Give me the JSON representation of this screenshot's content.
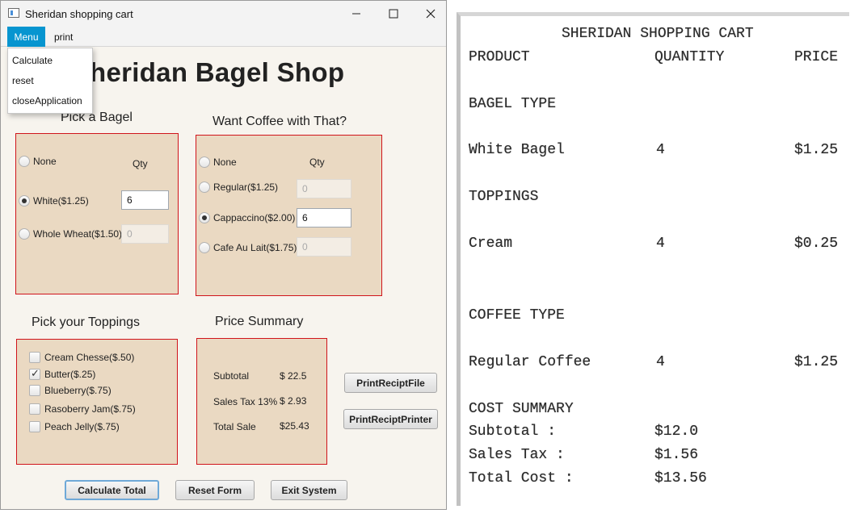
{
  "window": {
    "title": "Sheridan shopping cart",
    "controls": {
      "minimize": "—",
      "maximize": "☐",
      "close": "✕"
    }
  },
  "menubar": {
    "menu_label": "Menu",
    "print_label": "print",
    "dropdown_items": [
      "Calculate",
      "reset",
      "closeApplication"
    ]
  },
  "shop_title": "heridan Bagel Shop",
  "bagel_section": {
    "title": "Pick a Bagel",
    "qty_header": "Qty",
    "options": [
      {
        "label": "None",
        "selected": false,
        "qty": null
      },
      {
        "label": "White($1.25)",
        "selected": true,
        "qty": "6"
      },
      {
        "label": "Whole Wheat($1.50)",
        "selected": false,
        "qty": "0"
      }
    ]
  },
  "coffee_section": {
    "title": "Want Coffee with That?",
    "qty_header": "Qty",
    "options": [
      {
        "label": "None",
        "selected": false,
        "qty": null
      },
      {
        "label": "Regular($1.25)",
        "selected": false,
        "qty": "0"
      },
      {
        "label": "Cappaccino($2.00)",
        "selected": true,
        "qty": "6"
      },
      {
        "label": "Cafe Au Lait($1.75)",
        "selected": false,
        "qty": "0"
      }
    ]
  },
  "toppings_section": {
    "title": "Pick your Toppings",
    "items": [
      {
        "label": "Cream Chesse($.50)",
        "checked": false
      },
      {
        "label": "Butter($.25)",
        "checked": true
      },
      {
        "label": "Blueberry($.75)",
        "checked": false
      },
      {
        "label": "Rasoberry Jam($.75)",
        "checked": false
      },
      {
        "label": "Peach Jelly($.75)",
        "checked": false
      }
    ]
  },
  "price_summary": {
    "title": "Price Summary",
    "rows": [
      {
        "label": "Subtotal",
        "value": "$ 22.5"
      },
      {
        "label": "Sales Tax 13%",
        "value": "$ 2.93"
      },
      {
        "label": "Total Sale",
        "value": "$25.43"
      }
    ]
  },
  "print_buttons": {
    "file": "PrintReciptFile",
    "printer": "PrintReciptPrinter"
  },
  "bottom_buttons": {
    "calculate": "Calculate Total",
    "reset": "Reset Form",
    "exit": "Exit System"
  },
  "receipt": {
    "heading": "SHERIDAN SHOPPING CART",
    "col_product": "PRODUCT",
    "col_quantity": "QUANTITY",
    "col_price": "PRICE",
    "bagel_type_label": "BAGEL TYPE",
    "bagel_row": {
      "product": "White Bagel",
      "quantity": "4",
      "price": "$1.25"
    },
    "toppings_label": "TOPPINGS",
    "topping_row": {
      "product": "Cream",
      "quantity": "4",
      "price": "$0.25"
    },
    "coffee_type_label": "COFFEE TYPE",
    "coffee_row": {
      "product": "Regular Coffee",
      "quantity": "4",
      "price": "$1.25"
    },
    "cost_summary_label": "COST SUMMARY",
    "subtotal_label": "Subtotal :",
    "subtotal_value": "$12.0",
    "tax_label": "Sales Tax :",
    "tax_value": "$1.56",
    "total_label": "Total Cost :",
    "total_value": "$13.56"
  }
}
